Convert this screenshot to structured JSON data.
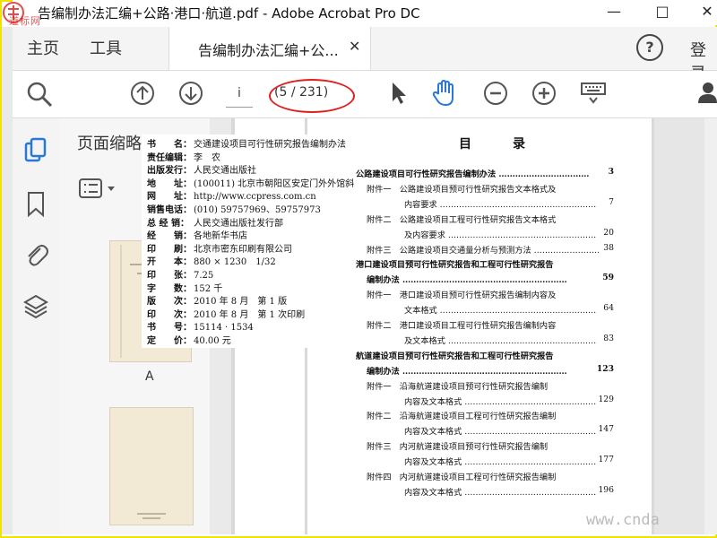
{
  "window": {
    "title": "告编制办法汇编+公路·港口·航道.pdf - Adobe Acrobat Pro DC",
    "minimize": "—",
    "maximize": "□",
    "close": "✕"
  },
  "logo_watermark": "道标网",
  "menu": {
    "home": "主页",
    "tools": "工具",
    "doc_tab": "告编制办法汇编+公...",
    "doc_tab_close": "✕",
    "help": "?",
    "login": "登录"
  },
  "toolbar": {
    "page_input_value": "i",
    "page_count": "(5 / 231)",
    "icons": [
      "zoom-search-icon",
      "page-up-icon",
      "page-down-icon",
      "select-cursor-icon",
      "hand-tool-icon",
      "zoom-out-icon",
      "zoom-in-icon",
      "keyboard-icon",
      "user-icon"
    ]
  },
  "sidenav": {
    "icons": [
      "page-thumbnails-icon",
      "bookmarks-icon",
      "attachments-icon",
      "layers-icon"
    ]
  },
  "thumbs": {
    "title": "页面缩略图",
    "options_icon": "list-options-icon",
    "page_a_label": "A"
  },
  "copyright_page": {
    "rows": [
      {
        "label": "书　　名：",
        "value": "交通建设项目可行性研究报告编制办法"
      },
      {
        "label": "责任编辑：",
        "value": "李　农"
      },
      {
        "label": "出版发行：",
        "value": "人民交通出版社"
      },
      {
        "label": "地　　址：",
        "value": "(100011) 北京市朝阳区安定门外外馆斜"
      },
      {
        "label": "网　　址：",
        "value": "http://www.ccpress.com.cn"
      },
      {
        "label": "销售电话：",
        "value": "(010) 59757969、59757973"
      },
      {
        "label": "总 经 销：",
        "value": "人民交通出版社发行部"
      },
      {
        "label": "经　　销：",
        "value": "各地新华书店"
      },
      {
        "label": "印　　刷：",
        "value": "北京市密东印刷有限公司"
      },
      {
        "label": "开　　本：",
        "value": "880 × 1230　1/32"
      },
      {
        "label": "印　　张：",
        "value": "7.25"
      },
      {
        "label": "字　　数：",
        "value": "152 千"
      },
      {
        "label": "版　　次：",
        "value": "2010 年 8 月　第 1 版"
      },
      {
        "label": "印　　次：",
        "value": "2010 年 8 月　第 1 次印刷"
      },
      {
        "label": "书　　号：",
        "value": "15114 · 1534"
      },
      {
        "label": "定　　价：",
        "value": "40.00 元"
      }
    ]
  },
  "toc": {
    "title": "目　录",
    "rows": [
      {
        "text": "公路建设项目可行性研究报告编制办法 ……………………………",
        "page": "3",
        "bold": true,
        "indent": 0
      },
      {
        "text": "附件一　公路建设项目预可行性研究报告文本格式及",
        "page": "",
        "bold": false,
        "indent": 12
      },
      {
        "text": "内容要求 …………………………………………………",
        "page": "7",
        "bold": false,
        "indent": 54
      },
      {
        "text": "附件二　公路建设项目工程可行性研究报告文本格式",
        "page": "",
        "bold": false,
        "indent": 12
      },
      {
        "text": "及内容要求 ………………………………………………",
        "page": "20",
        "bold": false,
        "indent": 54
      },
      {
        "text": "附件三　公路建设项目交通量分析与预测方法 ……………………",
        "page": "38",
        "bold": false,
        "indent": 12
      },
      {
        "text": "港口建设项目预可行性研究报告和工程可行性研究报告",
        "page": "",
        "bold": true,
        "indent": 0
      },
      {
        "text": "编制办法 ……………………………………………………",
        "page": "59",
        "bold": true,
        "indent": 12
      },
      {
        "text": "附件一　港口建设项目预可行性研究报告编制内容及",
        "page": "",
        "bold": false,
        "indent": 12
      },
      {
        "text": "文本格式 …………………………………………………",
        "page": "64",
        "bold": false,
        "indent": 54
      },
      {
        "text": "附件二　港口建设项目工程可行性研究报告编制内容",
        "page": "",
        "bold": false,
        "indent": 12
      },
      {
        "text": "及文本格式 ………………………………………………",
        "page": "83",
        "bold": false,
        "indent": 54
      },
      {
        "text": "航道建设项目预可行性研究报告和工程可行性研究报告",
        "page": "",
        "bold": true,
        "indent": 0
      },
      {
        "text": "编制办法 ……………………………………………………",
        "page": "123",
        "bold": true,
        "indent": 12
      },
      {
        "text": "附件一　沿海航道建设项目预可行性研究报告编制",
        "page": "",
        "bold": false,
        "indent": 12
      },
      {
        "text": "内容及文本格式 …………………………………………",
        "page": "129",
        "bold": false,
        "indent": 54
      },
      {
        "text": "附件二　沿海航道建设项目工程可行性研究报告编制",
        "page": "",
        "bold": false,
        "indent": 12
      },
      {
        "text": "内容及文本格式 …………………………………………",
        "page": "147",
        "bold": false,
        "indent": 54
      },
      {
        "text": "附件三　内河航道建设项目预可行性研究报告编制",
        "page": "",
        "bold": false,
        "indent": 12
      },
      {
        "text": "内容及文本格式 …………………………………………",
        "page": "177",
        "bold": false,
        "indent": 54
      },
      {
        "text": "附件四　内河航道建设项目工程可行性研究报告编制",
        "page": "",
        "bold": false,
        "indent": 12
      },
      {
        "text": "内容及文本格式 …………………………………………",
        "page": "196",
        "bold": false,
        "indent": 54
      }
    ]
  },
  "site_watermark": "www.cnda",
  "colors": {
    "accent_blue": "#2a78d6",
    "annotation_red": "#e02020",
    "frame_yellow": "#f2e200"
  }
}
